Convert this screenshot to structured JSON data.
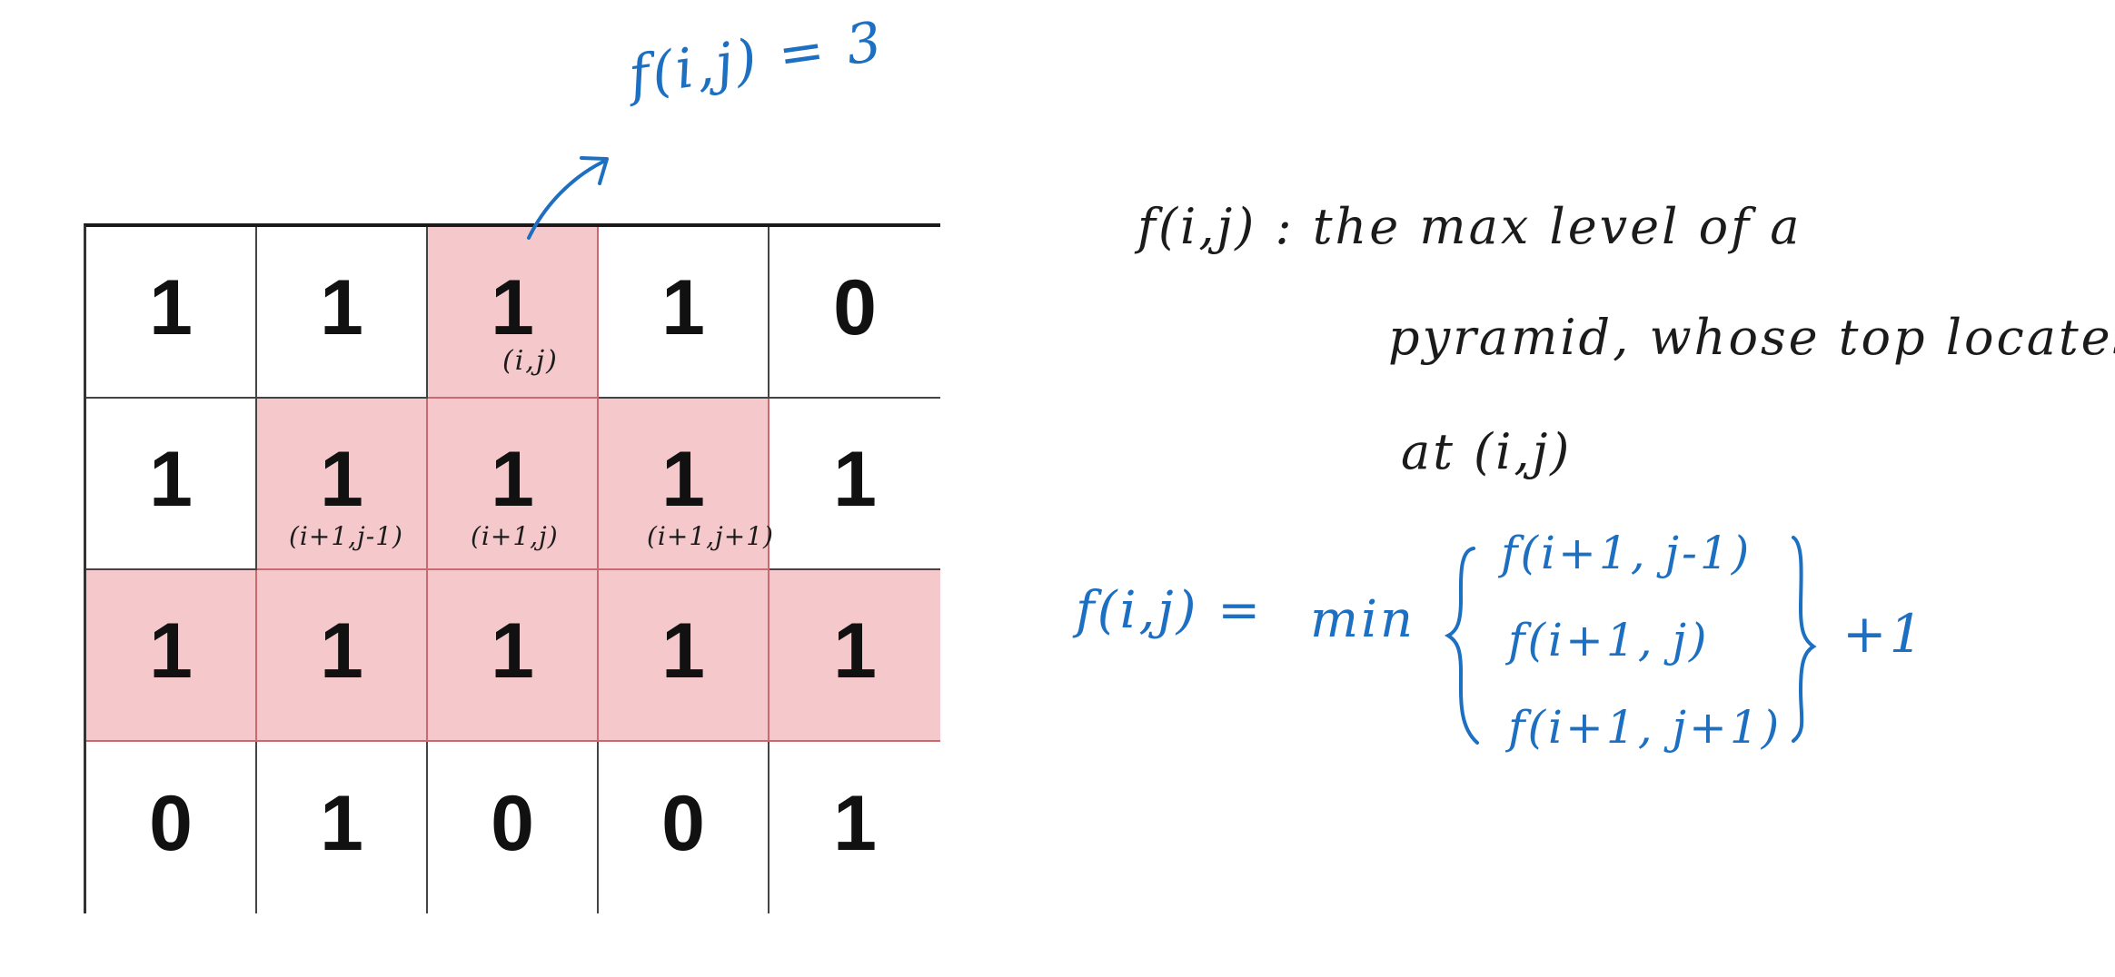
{
  "grid": {
    "rows": [
      [
        "1",
        "1",
        "1",
        "1",
        "0"
      ],
      [
        "1",
        "1",
        "1",
        "1",
        "1"
      ],
      [
        "1",
        "1",
        "1",
        "1",
        "1"
      ],
      [
        "0",
        "1",
        "0",
        "0",
        "1"
      ]
    ],
    "highlight": [
      [
        false,
        false,
        true,
        false,
        false
      ],
      [
        false,
        true,
        true,
        true,
        false
      ],
      [
        true,
        true,
        true,
        true,
        true
      ],
      [
        false,
        false,
        false,
        false,
        false
      ]
    ],
    "labels": {
      "top": "(i,j)",
      "left": "(i+1,j-1)",
      "mid": "(i+1,j)",
      "right": "(i+1,j+1)"
    }
  },
  "annotation": {
    "result": "f(i,j) = 3"
  },
  "definition": {
    "line1": "f(i,j) :  the max level of a",
    "line2": "pyramid,  whose top locates",
    "line3": "at (i,j)"
  },
  "formula": {
    "lhs": "f(i,j) =",
    "op": "min",
    "terms": [
      "f(i+1, j-1)",
      "f(i+1, j)",
      "f(i+1, j+1)"
    ],
    "plus": "+1"
  },
  "colors": {
    "highlight": "#f5c9cb",
    "ink_blue": "#1c6fc1",
    "ink_black": "#1b1b1b"
  }
}
